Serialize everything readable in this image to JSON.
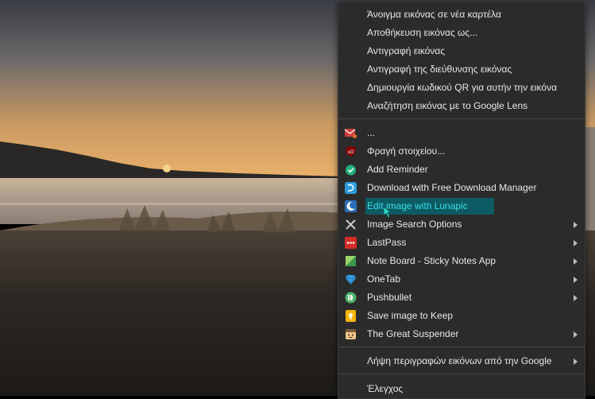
{
  "context_menu": {
    "top_items": [
      {
        "label": "Άνοιγμα εικόνας σε νέα καρτέλα"
      },
      {
        "label": "Αποθήκευση εικόνας ως..."
      },
      {
        "label": "Αντιγραφή εικόνας"
      },
      {
        "label": "Αντιγραφή της διεύθυνσης εικόνας"
      },
      {
        "label": "Δημιουργία κωδικού QR για αυτήν την εικόνα"
      },
      {
        "label": "Αναζήτηση εικόνας με το Google Lens"
      }
    ],
    "extension_items": [
      {
        "label": "...",
        "icon": "red-mail-icon",
        "submenu": false
      },
      {
        "label": "Φραγή στοιχείου...",
        "icon": "ublock-origin-icon",
        "submenu": false
      },
      {
        "label": "Add Reminder",
        "icon": "add-reminder-icon",
        "submenu": false
      },
      {
        "label": "Download with Free Download Manager",
        "icon": "fdm-icon",
        "submenu": false
      },
      {
        "label": "Edit image with Lunapic",
        "icon": "lunapic-icon",
        "submenu": false,
        "highlighted": true
      },
      {
        "label": "Image Search Options",
        "icon": "image-search-icon",
        "submenu": true
      },
      {
        "label": "LastPass",
        "icon": "lastpass-icon",
        "submenu": true
      },
      {
        "label": "Note Board - Sticky Notes App",
        "icon": "note-board-icon",
        "submenu": true
      },
      {
        "label": "OneTab",
        "icon": "onetab-icon",
        "submenu": true
      },
      {
        "label": "Pushbullet",
        "icon": "pushbullet-icon",
        "submenu": true
      },
      {
        "label": "Save image to Keep",
        "icon": "google-keep-icon",
        "submenu": false
      },
      {
        "label": "The Great Suspender",
        "icon": "great-suspender-icon",
        "submenu": true
      }
    ],
    "google_item": {
      "label": "Λήψη περιγραφών εικόνων από την Google",
      "submenu": true
    },
    "inspect_item": {
      "label": "Έλεγχος"
    }
  },
  "colors": {
    "menu_background": "#2b2b2b",
    "highlight_background": "#0e5a63",
    "highlight_text": "#34e0ea",
    "text": "#e8e8e8"
  }
}
